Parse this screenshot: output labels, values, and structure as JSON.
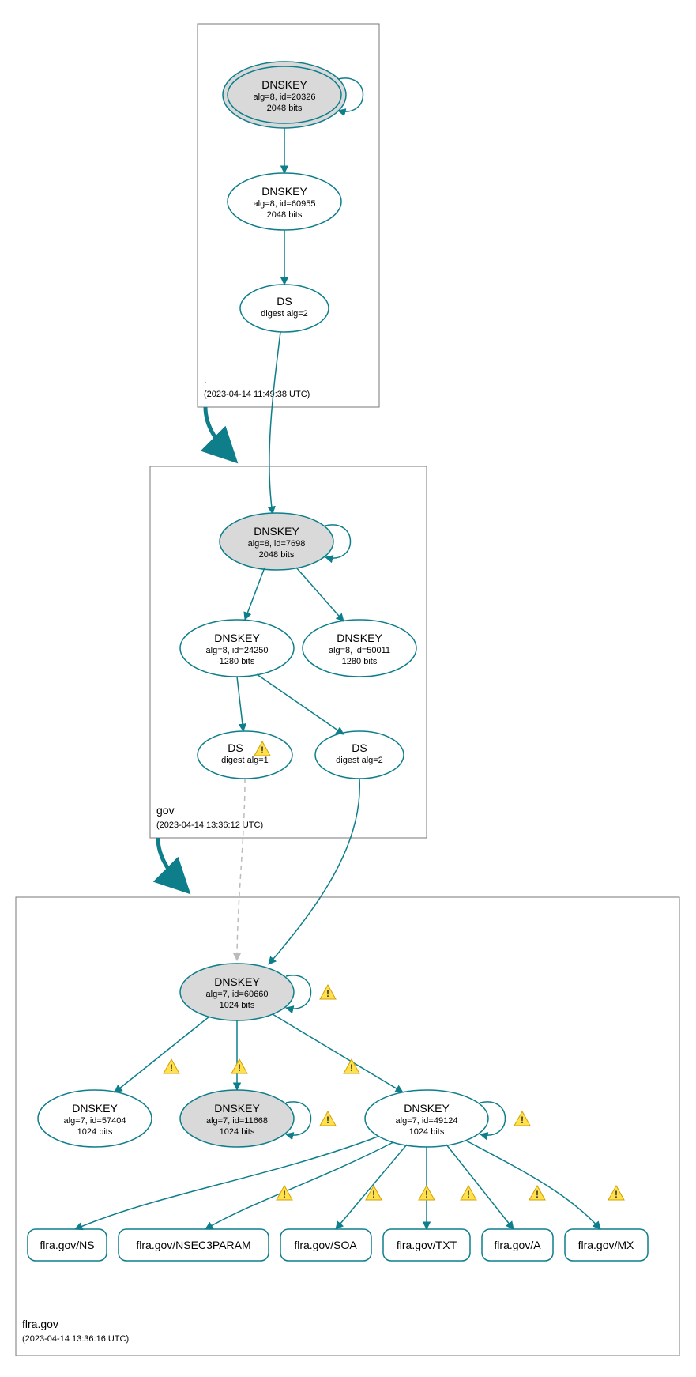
{
  "colors": {
    "teal": "#0d7e8a",
    "grayFill": "#d9d9d9",
    "warnFill": "#ffe14d",
    "warnStroke": "#d4a000"
  },
  "zones": {
    "root": {
      "label": ".",
      "timestamp": "(2023-04-14 11:49:38 UTC)"
    },
    "gov": {
      "label": "gov",
      "timestamp": "(2023-04-14 13:36:12 UTC)"
    },
    "flra": {
      "label": "flra.gov",
      "timestamp": "(2023-04-14 13:36:16 UTC)"
    }
  },
  "nodes": {
    "root_ksk": {
      "title": "DNSKEY",
      "l1": "alg=8, id=20326",
      "l2": "2048 bits"
    },
    "root_zsk": {
      "title": "DNSKEY",
      "l1": "alg=8, id=60955",
      "l2": "2048 bits"
    },
    "root_ds": {
      "title": "DS",
      "l1": "digest alg=2"
    },
    "gov_ksk": {
      "title": "DNSKEY",
      "l1": "alg=8, id=7698",
      "l2": "2048 bits"
    },
    "gov_zsk1": {
      "title": "DNSKEY",
      "l1": "alg=8, id=24250",
      "l2": "1280 bits"
    },
    "gov_zsk2": {
      "title": "DNSKEY",
      "l1": "alg=8, id=50011",
      "l2": "1280 bits"
    },
    "gov_ds1": {
      "title": "DS",
      "l1": "digest alg=1"
    },
    "gov_ds2": {
      "title": "DS",
      "l1": "digest alg=2"
    },
    "flra_ksk": {
      "title": "DNSKEY",
      "l1": "alg=7, id=60660",
      "l2": "1024 bits"
    },
    "flra_k1": {
      "title": "DNSKEY",
      "l1": "alg=7, id=57404",
      "l2": "1024 bits"
    },
    "flra_k2": {
      "title": "DNSKEY",
      "l1": "alg=7, id=11668",
      "l2": "1024 bits"
    },
    "flra_k3": {
      "title": "DNSKEY",
      "l1": "alg=7, id=49124",
      "l2": "1024 bits"
    }
  },
  "rrsets": {
    "ns": "flra.gov/NS",
    "nsec3": "flra.gov/NSEC3PARAM",
    "soa": "flra.gov/SOA",
    "txt": "flra.gov/TXT",
    "a": "flra.gov/A",
    "mx": "flra.gov/MX"
  },
  "icons": {
    "warn": "!"
  }
}
